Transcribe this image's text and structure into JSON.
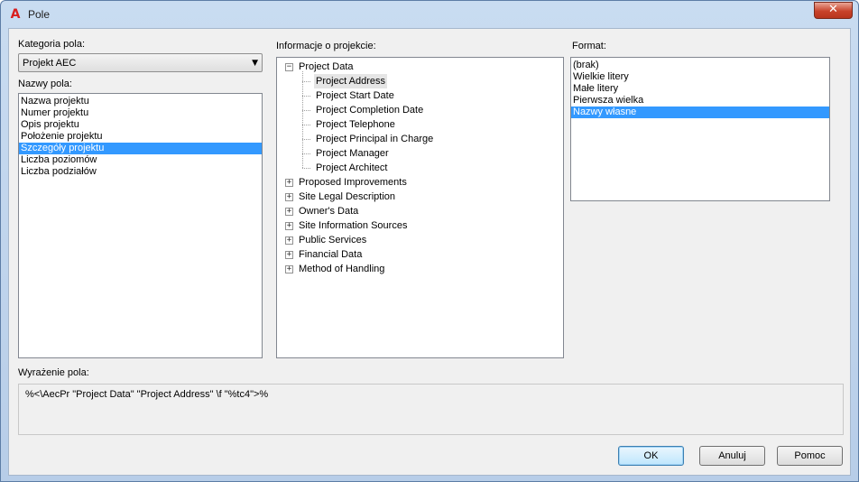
{
  "window": {
    "title": "Pole",
    "app_icon_glyph": "A",
    "close_glyph": "✕"
  },
  "category": {
    "label": "Kategoria pola:",
    "selected": "Projekt AEC",
    "arrow": "▼"
  },
  "field_names": {
    "label": "Nazwy pola:",
    "items": [
      {
        "text": "Nazwa projektu",
        "selected": false
      },
      {
        "text": "Numer projektu",
        "selected": false
      },
      {
        "text": "Opis projektu",
        "selected": false
      },
      {
        "text": "Położenie projektu",
        "selected": false
      },
      {
        "text": "Szczegóły projektu",
        "selected": true
      },
      {
        "text": "Liczba poziomów",
        "selected": false
      },
      {
        "text": "Liczba podziałów",
        "selected": false
      }
    ]
  },
  "project_info": {
    "label": "Informacje o projekcie:",
    "root": {
      "text": "Project Data",
      "expander": "−"
    },
    "children": [
      "Project Address",
      "Project Start Date",
      "Project Completion Date",
      "Project Telephone",
      "Project Principal in Charge",
      "Project Manager",
      "Project Architect"
    ],
    "selected_child": 0,
    "collapsed": [
      "Proposed Improvements",
      "Site Legal Description",
      "Owner's Data",
      "Site Information Sources",
      "Public Services",
      "Financial Data",
      "Method of Handling"
    ],
    "collapsed_expander": "+"
  },
  "format": {
    "label": "Format:",
    "items": [
      {
        "text": "(brak)",
        "selected": false
      },
      {
        "text": "Wielkie litery",
        "selected": false
      },
      {
        "text": "Małe litery",
        "selected": false
      },
      {
        "text": "Pierwsza wielka",
        "selected": false
      },
      {
        "text": "Nazwy własne",
        "selected": true
      }
    ]
  },
  "expression": {
    "label": "Wyrażenie pola:",
    "value": "%<\\AecPr \"Project Data\" \"Project Address\" \\f \"%tc4\">%"
  },
  "buttons": {
    "ok": "OK",
    "cancel": "Anuluj",
    "help": "Pomoc"
  },
  "colors": {
    "selection": "#3399ff",
    "client_bg": "#f0f0f0",
    "icon_red": "#d81e1e"
  }
}
